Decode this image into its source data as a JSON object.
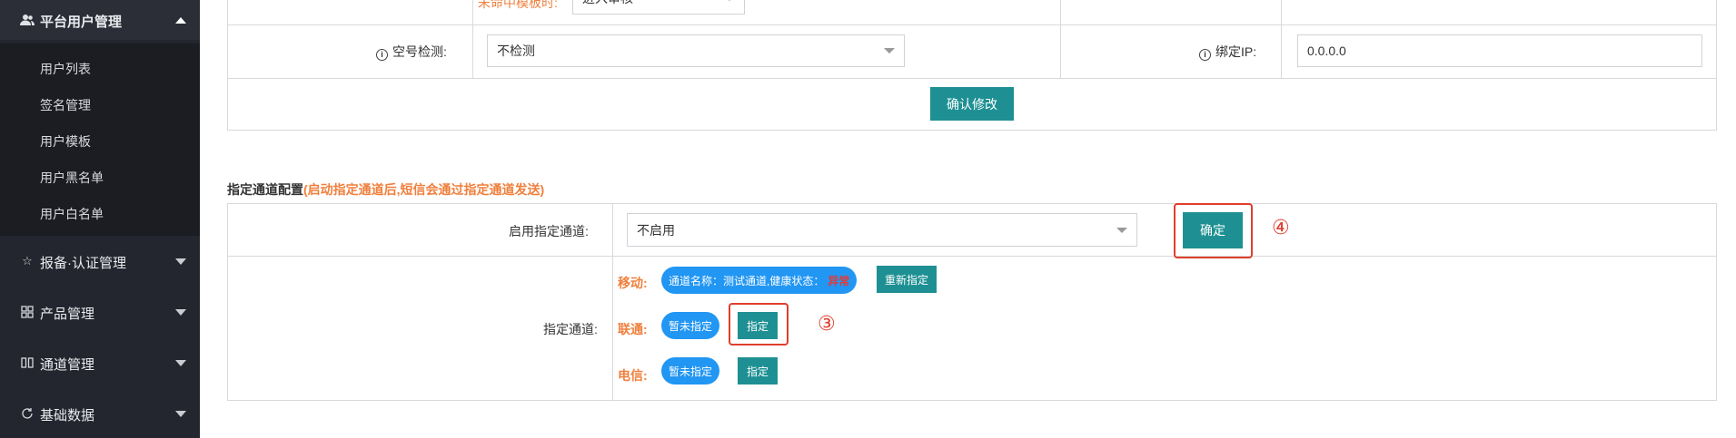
{
  "sidebar": {
    "groups": [
      {
        "label": "平台用户管理",
        "icon": "users-icon",
        "expanded": true
      },
      {
        "label": "报备·认证管理",
        "icon": "star-icon",
        "expanded": false
      },
      {
        "label": "产品管理",
        "icon": "grid-icon",
        "expanded": false
      },
      {
        "label": "通道管理",
        "icon": "columns-icon",
        "expanded": false
      },
      {
        "label": "基础数据",
        "icon": "refresh-icon",
        "expanded": false
      }
    ],
    "sub_items": [
      "用户列表",
      "签名管理",
      "用户模板",
      "用户黑名单",
      "用户白名单"
    ]
  },
  "form": {
    "partial_row": {
      "label": "未命中模板时:",
      "value": "进入审核"
    },
    "empty_check": {
      "label": "空号检测:",
      "value": "不检测"
    },
    "bind_ip": {
      "label": "绑定IP:",
      "value": "0.0.0.0"
    },
    "confirm_button": "确认修改"
  },
  "channel_config": {
    "title": "指定通道配置",
    "note": "(启动指定通道后,短信会通过指定通道发送)",
    "enable_label": "启用指定通道:",
    "enable_value": "不启用",
    "ok_button": "确定",
    "assign_label": "指定通道:",
    "carriers": [
      {
        "name": "移动:",
        "status_prefix": "通道名称：测试通道,健康状态：",
        "status_warn": "异常",
        "button": "重新指定"
      },
      {
        "name": "联通:",
        "status": "暂未指定",
        "button": "指定"
      },
      {
        "name": "电信:",
        "status": "暂未指定",
        "button": "指定"
      }
    ]
  },
  "annotations": {
    "step3": "③",
    "step4": "④",
    "color": "#e03e2d"
  },
  "colors": {
    "sidebar_bg": "#23262e",
    "submenu_bg": "#1b1d22",
    "accent": "#1e9093",
    "pill": "#2196f3",
    "orange": "#f07f3c"
  }
}
